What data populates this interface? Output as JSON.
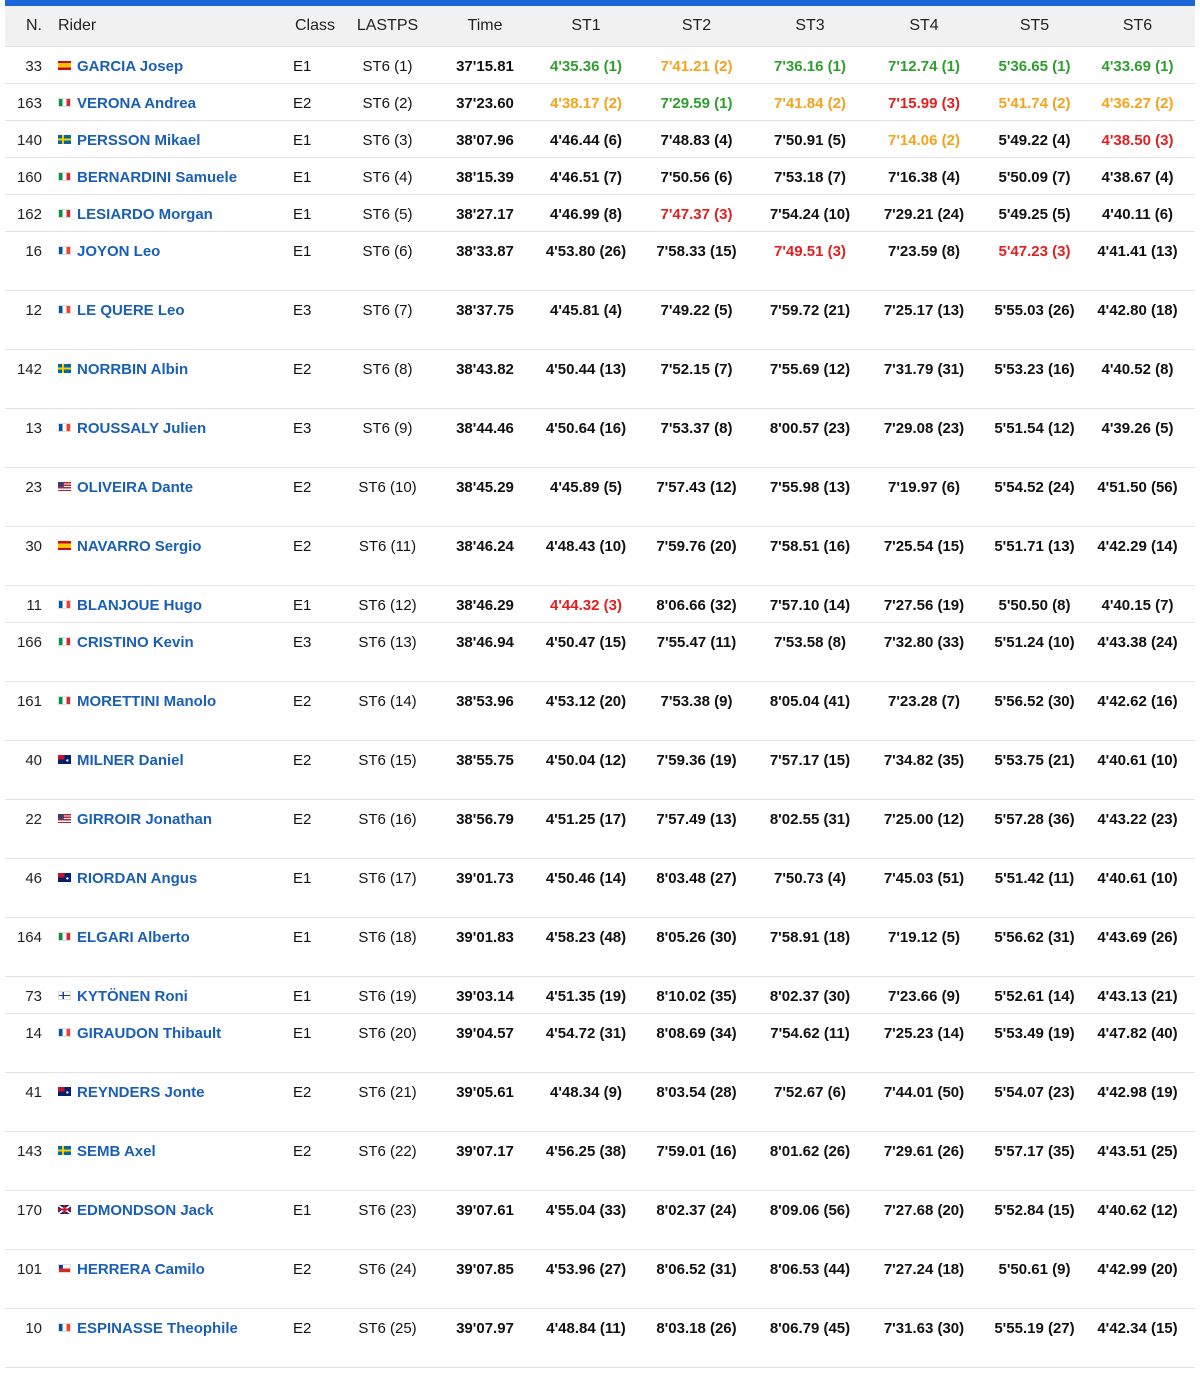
{
  "table": {
    "headers": {
      "no": "N.",
      "rider": "Rider",
      "class": "Class",
      "lastps": "LASTPS",
      "time": "Time",
      "st1": "ST1",
      "st2": "ST2",
      "st3": "ST3",
      "st4": "ST4",
      "st5": "ST5",
      "st6": "ST6"
    },
    "rank_colors": {
      "1": "#2e9e2e",
      "2": "#f3a31c",
      "3": "#e21f1f",
      "link": "#1a5fb4",
      "accent_bar": "#1a66d9"
    },
    "rows": [
      {
        "no": "33",
        "flag": "es",
        "rider": "GARCIA Josep",
        "class": "E1",
        "lastps": "ST6 (1)",
        "time": "37'15.81",
        "st": [
          {
            "t": "4'35.36 (1)",
            "r": 1
          },
          {
            "t": "7'41.21 (2)",
            "r": 2
          },
          {
            "t": "7'36.16 (1)",
            "r": 1
          },
          {
            "t": "7'12.74 (1)",
            "r": 1
          },
          {
            "t": "5'36.65 (1)",
            "r": 1
          },
          {
            "t": "4'33.69 (1)",
            "r": 1
          }
        ]
      },
      {
        "no": "163",
        "flag": "it",
        "rider": "VERONA Andrea",
        "class": "E2",
        "lastps": "ST6 (2)",
        "time": "37'23.60",
        "st": [
          {
            "t": "4'38.17 (2)",
            "r": 2
          },
          {
            "t": "7'29.59 (1)",
            "r": 1
          },
          {
            "t": "7'41.84 (2)",
            "r": 2
          },
          {
            "t": "7'15.99 (3)",
            "r": 3
          },
          {
            "t": "5'41.74 (2)",
            "r": 2
          },
          {
            "t": "4'36.27 (2)",
            "r": 2
          }
        ]
      },
      {
        "no": "140",
        "flag": "se",
        "rider": "PERSSON Mikael",
        "class": "E1",
        "lastps": "ST6 (3)",
        "time": "38'07.96",
        "st": [
          {
            "t": "4'46.44 (6)",
            "r": 0
          },
          {
            "t": "7'48.83 (4)",
            "r": 0
          },
          {
            "t": "7'50.91 (5)",
            "r": 0
          },
          {
            "t": "7'14.06 (2)",
            "r": 2
          },
          {
            "t": "5'49.22 (4)",
            "r": 0
          },
          {
            "t": "4'38.50 (3)",
            "r": 3
          }
        ]
      },
      {
        "no": "160",
        "flag": "it",
        "rider": "BERNARDINI Samuele",
        "class": "E1",
        "lastps": "ST6 (4)",
        "time": "38'15.39",
        "st": [
          {
            "t": "4'46.51 (7)",
            "r": 0
          },
          {
            "t": "7'50.56 (6)",
            "r": 0
          },
          {
            "t": "7'53.18 (7)",
            "r": 0
          },
          {
            "t": "7'16.38 (4)",
            "r": 0
          },
          {
            "t": "5'50.09 (7)",
            "r": 0
          },
          {
            "t": "4'38.67 (4)",
            "r": 0
          }
        ]
      },
      {
        "no": "162",
        "flag": "it",
        "rider": "LESIARDO Morgan",
        "class": "E1",
        "lastps": "ST6 (5)",
        "time": "38'27.17",
        "st": [
          {
            "t": "4'46.99 (8)",
            "r": 0
          },
          {
            "t": "7'47.37 (3)",
            "r": 3
          },
          {
            "t": "7'54.24 (10)",
            "r": 0
          },
          {
            "t": "7'29.21 (24)",
            "r": 0
          },
          {
            "t": "5'49.25 (5)",
            "r": 0
          },
          {
            "t": "4'40.11 (6)",
            "r": 0
          }
        ]
      },
      {
        "no": "16",
        "flag": "fr",
        "rider": "JOYON Leo",
        "class": "E1",
        "lastps": "ST6 (6)",
        "time": "38'33.87",
        "st": [
          {
            "t": "4'53.80 (26)",
            "r": 0
          },
          {
            "t": "7'58.33 (15)",
            "r": 0
          },
          {
            "t": "7'49.51 (3)",
            "r": 3
          },
          {
            "t": "7'23.59 (8)",
            "r": 0
          },
          {
            "t": "5'47.23 (3)",
            "r": 3
          },
          {
            "t": "4'41.41 (13)",
            "r": 0
          }
        ]
      },
      {
        "no": "12",
        "flag": "fr",
        "rider": "LE QUERE Leo",
        "class": "E3",
        "lastps": "ST6 (7)",
        "time": "38'37.75",
        "st": [
          {
            "t": "4'45.81 (4)",
            "r": 0
          },
          {
            "t": "7'49.22 (5)",
            "r": 0
          },
          {
            "t": "7'59.72 (21)",
            "r": 0
          },
          {
            "t": "7'25.17 (13)",
            "r": 0
          },
          {
            "t": "5'55.03 (26)",
            "r": 0
          },
          {
            "t": "4'42.80 (18)",
            "r": 0
          }
        ]
      },
      {
        "no": "142",
        "flag": "se",
        "rider": "NORRBIN Albin",
        "class": "E2",
        "lastps": "ST6 (8)",
        "time": "38'43.82",
        "st": [
          {
            "t": "4'50.44 (13)",
            "r": 0
          },
          {
            "t": "7'52.15 (7)",
            "r": 0
          },
          {
            "t": "7'55.69 (12)",
            "r": 0
          },
          {
            "t": "7'31.79 (31)",
            "r": 0
          },
          {
            "t": "5'53.23 (16)",
            "r": 0
          },
          {
            "t": "4'40.52 (8)",
            "r": 0
          }
        ]
      },
      {
        "no": "13",
        "flag": "fr",
        "rider": "ROUSSALY Julien",
        "class": "E3",
        "lastps": "ST6 (9)",
        "time": "38'44.46",
        "st": [
          {
            "t": "4'50.64 (16)",
            "r": 0
          },
          {
            "t": "7'53.37 (8)",
            "r": 0
          },
          {
            "t": "8'00.57 (23)",
            "r": 0
          },
          {
            "t": "7'29.08 (23)",
            "r": 0
          },
          {
            "t": "5'51.54 (12)",
            "r": 0
          },
          {
            "t": "4'39.26 (5)",
            "r": 0
          }
        ]
      },
      {
        "no": "23",
        "flag": "us",
        "rider": "OLIVEIRA Dante",
        "class": "E2",
        "lastps": "ST6 (10)",
        "time": "38'45.29",
        "st": [
          {
            "t": "4'45.89 (5)",
            "r": 0
          },
          {
            "t": "7'57.43 (12)",
            "r": 0
          },
          {
            "t": "7'55.98 (13)",
            "r": 0
          },
          {
            "t": "7'19.97 (6)",
            "r": 0
          },
          {
            "t": "5'54.52 (24)",
            "r": 0
          },
          {
            "t": "4'51.50 (56)",
            "r": 0
          }
        ]
      },
      {
        "no": "30",
        "flag": "es",
        "rider": "NAVARRO Sergio",
        "class": "E2",
        "lastps": "ST6 (11)",
        "time": "38'46.24",
        "st": [
          {
            "t": "4'48.43 (10)",
            "r": 0
          },
          {
            "t": "7'59.76 (20)",
            "r": 0
          },
          {
            "t": "7'58.51 (16)",
            "r": 0
          },
          {
            "t": "7'25.54 (15)",
            "r": 0
          },
          {
            "t": "5'51.71 (13)",
            "r": 0
          },
          {
            "t": "4'42.29 (14)",
            "r": 0
          }
        ]
      },
      {
        "no": "11",
        "flag": "fr",
        "rider": "BLANJOUE Hugo",
        "class": "E1",
        "lastps": "ST6 (12)",
        "time": "38'46.29",
        "st": [
          {
            "t": "4'44.32 (3)",
            "r": 3
          },
          {
            "t": "8'06.66 (32)",
            "r": 0
          },
          {
            "t": "7'57.10 (14)",
            "r": 0
          },
          {
            "t": "7'27.56 (19)",
            "r": 0
          },
          {
            "t": "5'50.50 (8)",
            "r": 0
          },
          {
            "t": "4'40.15 (7)",
            "r": 0
          }
        ]
      },
      {
        "no": "166",
        "flag": "it",
        "rider": "CRISTINO Kevin",
        "class": "E3",
        "lastps": "ST6 (13)",
        "time": "38'46.94",
        "st": [
          {
            "t": "4'50.47 (15)",
            "r": 0
          },
          {
            "t": "7'55.47 (11)",
            "r": 0
          },
          {
            "t": "7'53.58 (8)",
            "r": 0
          },
          {
            "t": "7'32.80 (33)",
            "r": 0
          },
          {
            "t": "5'51.24 (10)",
            "r": 0
          },
          {
            "t": "4'43.38 (24)",
            "r": 0
          }
        ]
      },
      {
        "no": "161",
        "flag": "it",
        "rider": "MORETTINI Manolo",
        "class": "E2",
        "lastps": "ST6 (14)",
        "time": "38'53.96",
        "st": [
          {
            "t": "4'53.12 (20)",
            "r": 0
          },
          {
            "t": "7'53.38 (9)",
            "r": 0
          },
          {
            "t": "8'05.04 (41)",
            "r": 0
          },
          {
            "t": "7'23.28 (7)",
            "r": 0
          },
          {
            "t": "5'56.52 (30)",
            "r": 0
          },
          {
            "t": "4'42.62 (16)",
            "r": 0
          }
        ]
      },
      {
        "no": "40",
        "flag": "au",
        "rider": "MILNER Daniel",
        "class": "E2",
        "lastps": "ST6 (15)",
        "time": "38'55.75",
        "st": [
          {
            "t": "4'50.04 (12)",
            "r": 0
          },
          {
            "t": "7'59.36 (19)",
            "r": 0
          },
          {
            "t": "7'57.17 (15)",
            "r": 0
          },
          {
            "t": "7'34.82 (35)",
            "r": 0
          },
          {
            "t": "5'53.75 (21)",
            "r": 0
          },
          {
            "t": "4'40.61 (10)",
            "r": 0
          }
        ]
      },
      {
        "no": "22",
        "flag": "us",
        "rider": "GIRROIR Jonathan",
        "class": "E2",
        "lastps": "ST6 (16)",
        "time": "38'56.79",
        "st": [
          {
            "t": "4'51.25 (17)",
            "r": 0
          },
          {
            "t": "7'57.49 (13)",
            "r": 0
          },
          {
            "t": "8'02.55 (31)",
            "r": 0
          },
          {
            "t": "7'25.00 (12)",
            "r": 0
          },
          {
            "t": "5'57.28 (36)",
            "r": 0
          },
          {
            "t": "4'43.22 (23)",
            "r": 0
          }
        ]
      },
      {
        "no": "46",
        "flag": "au",
        "rider": "RIORDAN Angus",
        "class": "E1",
        "lastps": "ST6 (17)",
        "time": "39'01.73",
        "st": [
          {
            "t": "4'50.46 (14)",
            "r": 0
          },
          {
            "t": "8'03.48 (27)",
            "r": 0
          },
          {
            "t": "7'50.73 (4)",
            "r": 0
          },
          {
            "t": "7'45.03 (51)",
            "r": 0
          },
          {
            "t": "5'51.42 (11)",
            "r": 0
          },
          {
            "t": "4'40.61 (10)",
            "r": 0
          }
        ]
      },
      {
        "no": "164",
        "flag": "it",
        "rider": "ELGARI Alberto",
        "class": "E1",
        "lastps": "ST6 (18)",
        "time": "39'01.83",
        "st": [
          {
            "t": "4'58.23 (48)",
            "r": 0
          },
          {
            "t": "8'05.26 (30)",
            "r": 0
          },
          {
            "t": "7'58.91 (18)",
            "r": 0
          },
          {
            "t": "7'19.12 (5)",
            "r": 0
          },
          {
            "t": "5'56.62 (31)",
            "r": 0
          },
          {
            "t": "4'43.69 (26)",
            "r": 0
          }
        ]
      },
      {
        "no": "73",
        "flag": "fi",
        "rider": "KYTÖNEN Roni",
        "class": "E1",
        "lastps": "ST6 (19)",
        "time": "39'03.14",
        "st": [
          {
            "t": "4'51.35 (19)",
            "r": 0
          },
          {
            "t": "8'10.02 (35)",
            "r": 0
          },
          {
            "t": "8'02.37 (30)",
            "r": 0
          },
          {
            "t": "7'23.66 (9)",
            "r": 0
          },
          {
            "t": "5'52.61 (14)",
            "r": 0
          },
          {
            "t": "4'43.13 (21)",
            "r": 0
          }
        ]
      },
      {
        "no": "14",
        "flag": "fr",
        "rider": "GIRAUDON Thibault",
        "class": "E1",
        "lastps": "ST6 (20)",
        "time": "39'04.57",
        "st": [
          {
            "t": "4'54.72 (31)",
            "r": 0
          },
          {
            "t": "8'08.69 (34)",
            "r": 0
          },
          {
            "t": "7'54.62 (11)",
            "r": 0
          },
          {
            "t": "7'25.23 (14)",
            "r": 0
          },
          {
            "t": "5'53.49 (19)",
            "r": 0
          },
          {
            "t": "4'47.82 (40)",
            "r": 0
          }
        ]
      },
      {
        "no": "41",
        "flag": "au",
        "rider": "REYNDERS Jonte",
        "class": "E2",
        "lastps": "ST6 (21)",
        "time": "39'05.61",
        "st": [
          {
            "t": "4'48.34 (9)",
            "r": 0
          },
          {
            "t": "8'03.54 (28)",
            "r": 0
          },
          {
            "t": "7'52.67 (6)",
            "r": 0
          },
          {
            "t": "7'44.01 (50)",
            "r": 0
          },
          {
            "t": "5'54.07 (23)",
            "r": 0
          },
          {
            "t": "4'42.98 (19)",
            "r": 0
          }
        ]
      },
      {
        "no": "143",
        "flag": "se",
        "rider": "SEMB Axel",
        "class": "E2",
        "lastps": "ST6 (22)",
        "time": "39'07.17",
        "st": [
          {
            "t": "4'56.25 (38)",
            "r": 0
          },
          {
            "t": "7'59.01 (16)",
            "r": 0
          },
          {
            "t": "8'01.62 (26)",
            "r": 0
          },
          {
            "t": "7'29.61 (26)",
            "r": 0
          },
          {
            "t": "5'57.17 (35)",
            "r": 0
          },
          {
            "t": "4'43.51 (25)",
            "r": 0
          }
        ]
      },
      {
        "no": "170",
        "flag": "gb",
        "rider": "EDMONDSON Jack",
        "class": "E1",
        "lastps": "ST6 (23)",
        "time": "39'07.61",
        "st": [
          {
            "t": "4'55.04 (33)",
            "r": 0
          },
          {
            "t": "8'02.37 (24)",
            "r": 0
          },
          {
            "t": "8'09.06 (56)",
            "r": 0
          },
          {
            "t": "7'27.68 (20)",
            "r": 0
          },
          {
            "t": "5'52.84 (15)",
            "r": 0
          },
          {
            "t": "4'40.62 (12)",
            "r": 0
          }
        ]
      },
      {
        "no": "101",
        "flag": "cl",
        "rider": "HERRERA Camilo",
        "class": "E2",
        "lastps": "ST6 (24)",
        "time": "39'07.85",
        "st": [
          {
            "t": "4'53.96 (27)",
            "r": 0
          },
          {
            "t": "8'06.52 (31)",
            "r": 0
          },
          {
            "t": "8'06.53 (44)",
            "r": 0
          },
          {
            "t": "7'27.24 (18)",
            "r": 0
          },
          {
            "t": "5'50.61 (9)",
            "r": 0
          },
          {
            "t": "4'42.99 (20)",
            "r": 0
          }
        ]
      },
      {
        "no": "10",
        "flag": "fr",
        "rider": "ESPINASSE Theophile",
        "class": "E2",
        "lastps": "ST6 (25)",
        "time": "39'07.97",
        "st": [
          {
            "t": "4'48.84 (11)",
            "r": 0
          },
          {
            "t": "8'03.18 (26)",
            "r": 0
          },
          {
            "t": "8'06.79 (45)",
            "r": 0
          },
          {
            "t": "7'31.63 (30)",
            "r": 0
          },
          {
            "t": "5'55.19 (27)",
            "r": 0
          },
          {
            "t": "4'42.34 (15)",
            "r": 0
          }
        ]
      }
    ]
  }
}
